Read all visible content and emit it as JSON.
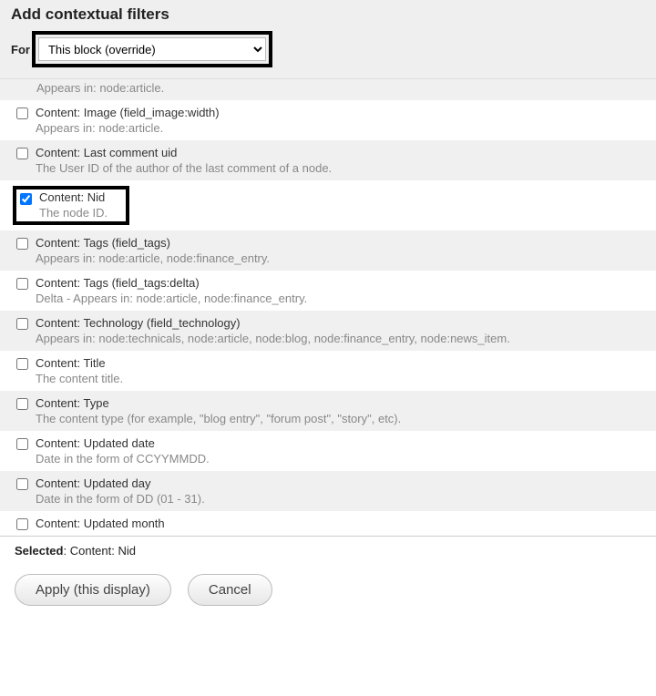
{
  "header": {
    "title": "Add contextual filters",
    "for_label": "For",
    "select_value": "This block (override)"
  },
  "partial_first_desc": "Appears in: node:article.",
  "filters": [
    {
      "label": "Content: Image (field_image:width)",
      "desc": "Appears in: node:article.",
      "checked": false,
      "alt": false,
      "highlight": false
    },
    {
      "label": "Content: Last comment uid",
      "desc": "The User ID of the author of the last comment of a node.",
      "checked": false,
      "alt": true,
      "highlight": false
    },
    {
      "label": "Content: Nid",
      "desc": "The node ID.",
      "checked": true,
      "alt": false,
      "highlight": true
    },
    {
      "label": "Content: Tags (field_tags)",
      "desc": "Appears in: node:article, node:finance_entry.",
      "checked": false,
      "alt": true,
      "highlight": false
    },
    {
      "label": "Content: Tags (field_tags:delta)",
      "desc": "Delta - Appears in: node:article, node:finance_entry.",
      "checked": false,
      "alt": false,
      "highlight": false
    },
    {
      "label": "Content: Technology (field_technology)",
      "desc": "Appears in: node:technicals, node:article, node:blog, node:finance_entry, node:news_item.",
      "checked": false,
      "alt": true,
      "highlight": false
    },
    {
      "label": "Content: Title",
      "desc": "The content title.",
      "checked": false,
      "alt": false,
      "highlight": false
    },
    {
      "label": "Content: Type",
      "desc": "The content type (for example, \"blog entry\", \"forum post\", \"story\", etc).",
      "checked": false,
      "alt": true,
      "highlight": false
    },
    {
      "label": "Content: Updated date",
      "desc": "Date in the form of CCYYMMDD.",
      "checked": false,
      "alt": false,
      "highlight": false
    },
    {
      "label": "Content: Updated day",
      "desc": "Date in the form of DD (01 - 31).",
      "checked": false,
      "alt": true,
      "highlight": false
    },
    {
      "label": "Content: Updated month",
      "desc": "",
      "checked": false,
      "alt": false,
      "highlight": false
    }
  ],
  "selected": {
    "label": "Selected",
    "value": "Content: Nid"
  },
  "buttons": {
    "apply": "Apply (this display)",
    "cancel": "Cancel"
  }
}
